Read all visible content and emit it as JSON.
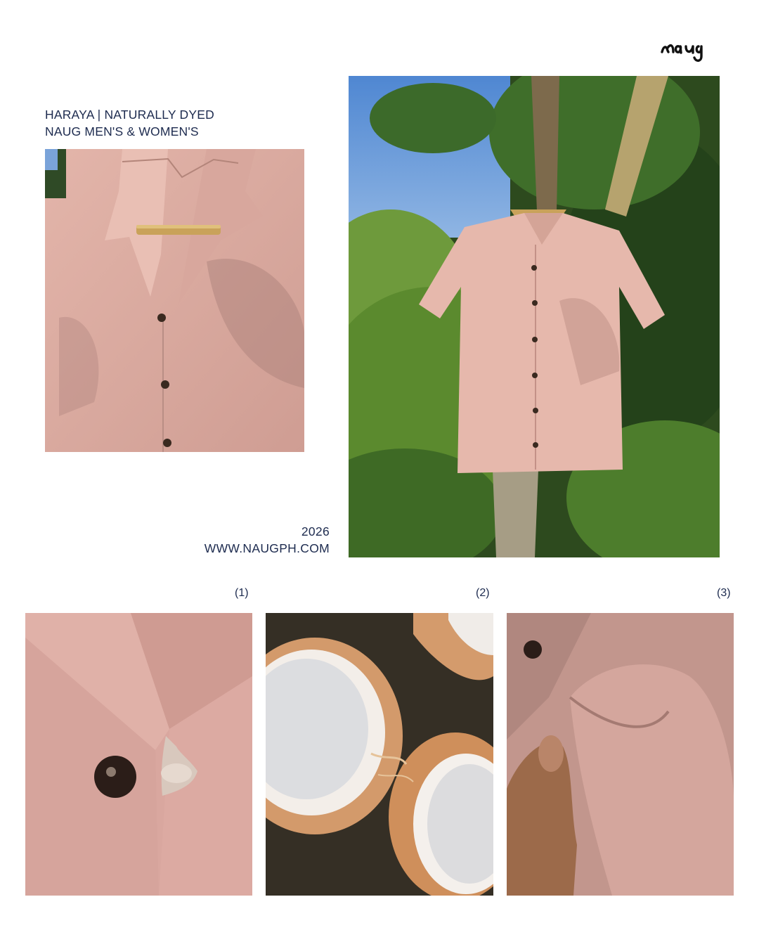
{
  "brand": {
    "logo_text": "naug"
  },
  "header": {
    "line1": "HARAYA | NATURALLY DYED",
    "line2": "NAUG MEN'S & WOMEN'S"
  },
  "footer_info": {
    "year": "2026",
    "website": "WWW.NAUGPH.COM"
  },
  "details": [
    {
      "number": "(1)",
      "image": "coconut-button-closeup"
    },
    {
      "number": "(2)",
      "image": "halved-young-coconuts"
    },
    {
      "number": "(3)",
      "image": "linen-fabric-with-hand"
    }
  ],
  "photos": {
    "shirt_closeup": "pink-camp-collar-shirt-closeup",
    "shirt_on_tree": "pink-shirt-hanging-on-tree"
  },
  "colors": {
    "text": "#1d2b4f",
    "shirt_pink": "#d9a9a0",
    "foliage": "#3d6a2a",
    "sky": "#5f93d6"
  }
}
